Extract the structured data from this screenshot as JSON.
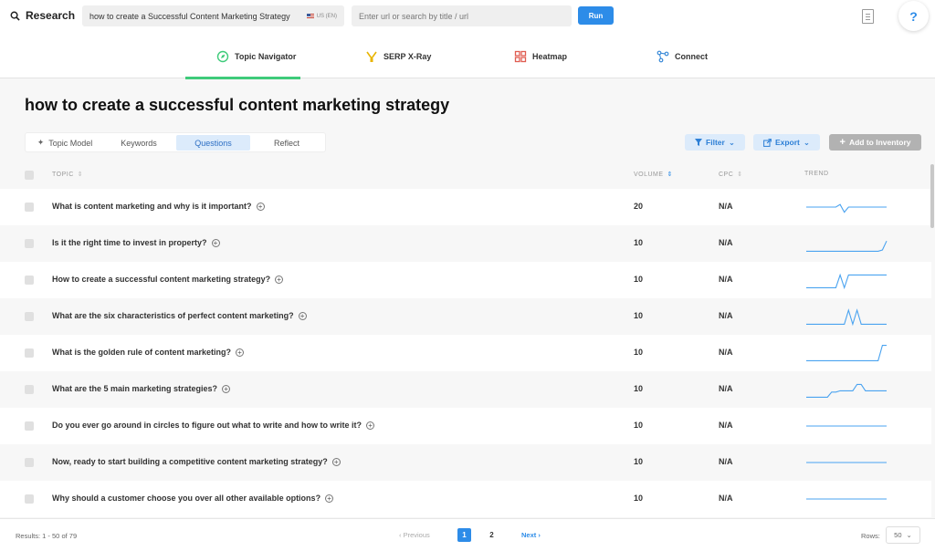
{
  "app": {
    "title": "Research"
  },
  "search": {
    "query": "how to create a Successful Content Marketing Strategy",
    "locale": "US (EN)",
    "url_placeholder": "Enter url or search by title / url",
    "run_label": "Run"
  },
  "help_label": "?",
  "nav_tabs": [
    {
      "label": "Topic Navigator",
      "icon": "compass-icon",
      "active": true
    },
    {
      "label": "SERP X-Ray",
      "icon": "xray-icon",
      "active": false
    },
    {
      "label": "Heatmap",
      "icon": "heatmap-icon",
      "active": false
    },
    {
      "label": "Connect",
      "icon": "connect-icon",
      "active": false
    }
  ],
  "page_title": "how to create a successful content marketing strategy",
  "sub_tabs": [
    {
      "label": "Topic Model",
      "active": false
    },
    {
      "label": "Keywords",
      "active": false
    },
    {
      "label": "Questions",
      "active": true
    },
    {
      "label": "Reflect",
      "active": false
    }
  ],
  "actions": {
    "filter": "Filter",
    "export": "Export",
    "add": "Add to Inventory"
  },
  "table": {
    "headers": {
      "topic": "TOPIC",
      "volume": "VOLUME",
      "cpc": "CPC",
      "trend": "TREND"
    },
    "rows": [
      {
        "question": "What is content marketing and why is it important?",
        "volume": "20",
        "cpc": "N/A",
        "trend": [
          50,
          50,
          50,
          50,
          50,
          50,
          50,
          50,
          60,
          30,
          50,
          50,
          50,
          50,
          50,
          50,
          50,
          50,
          50,
          50
        ]
      },
      {
        "question": "Is it the right time to invest in property?",
        "volume": "10",
        "cpc": "N/A",
        "trend": [
          20,
          20,
          20,
          20,
          20,
          20,
          20,
          20,
          20,
          20,
          20,
          20,
          20,
          20,
          20,
          20,
          20,
          20,
          25,
          60
        ]
      },
      {
        "question": "How to create a successful content marketing strategy?",
        "volume": "10",
        "cpc": "N/A",
        "trend": [
          20,
          20,
          20,
          20,
          20,
          20,
          20,
          20,
          70,
          20,
          70,
          70,
          70,
          70,
          70,
          70,
          70,
          70,
          70,
          70
        ]
      },
      {
        "question": "What are the six characteristics of perfect content marketing?",
        "volume": "10",
        "cpc": "N/A",
        "trend": [
          20,
          20,
          20,
          20,
          20,
          20,
          20,
          20,
          20,
          20,
          75,
          20,
          75,
          20,
          20,
          20,
          20,
          20,
          20,
          20
        ]
      },
      {
        "question": "What is the golden rule of content marketing?",
        "volume": "10",
        "cpc": "N/A",
        "trend": [
          20,
          20,
          20,
          20,
          20,
          20,
          20,
          20,
          20,
          20,
          20,
          20,
          20,
          20,
          20,
          20,
          20,
          20,
          80,
          80
        ]
      },
      {
        "question": "What are the 5 main marketing strategies?",
        "volume": "10",
        "cpc": "N/A",
        "trend": [
          20,
          20,
          20,
          20,
          20,
          20,
          40,
          40,
          45,
          45,
          45,
          45,
          70,
          70,
          45,
          45,
          45,
          45,
          45,
          45
        ]
      },
      {
        "question": "Do you ever go around in circles to figure out what to write and how to write it?",
        "volume": "10",
        "cpc": "N/A",
        "trend": [
          50,
          50,
          50,
          50,
          50,
          50,
          50,
          50,
          50,
          50,
          50,
          50,
          50,
          50,
          50,
          50,
          50,
          50,
          50,
          50
        ]
      },
      {
        "question": "Now, ready to start building a competitive content marketing strategy?",
        "volume": "10",
        "cpc": "N/A",
        "trend": [
          50,
          50,
          50,
          50,
          50,
          50,
          50,
          50,
          50,
          50,
          50,
          50,
          50,
          50,
          50,
          50,
          50,
          50,
          50,
          50
        ]
      },
      {
        "question": "Why should a customer choose you over all other available options?",
        "volume": "10",
        "cpc": "N/A",
        "trend": [
          50,
          50,
          50,
          50,
          50,
          50,
          50,
          50,
          50,
          50,
          50,
          50,
          50,
          50,
          50,
          50,
          50,
          50,
          50,
          50
        ]
      }
    ]
  },
  "pagination": {
    "results": "Results: 1 - 50 of 79",
    "prev": "Previous",
    "pages": [
      "1",
      "2"
    ],
    "current": "1",
    "next": "Next",
    "rows_label": "Rows:",
    "rows_value": "50"
  },
  "colors": {
    "accent": "#2d8ce8",
    "active_tab": "#3ecb7a",
    "trend_line": "#4aa3f0"
  }
}
